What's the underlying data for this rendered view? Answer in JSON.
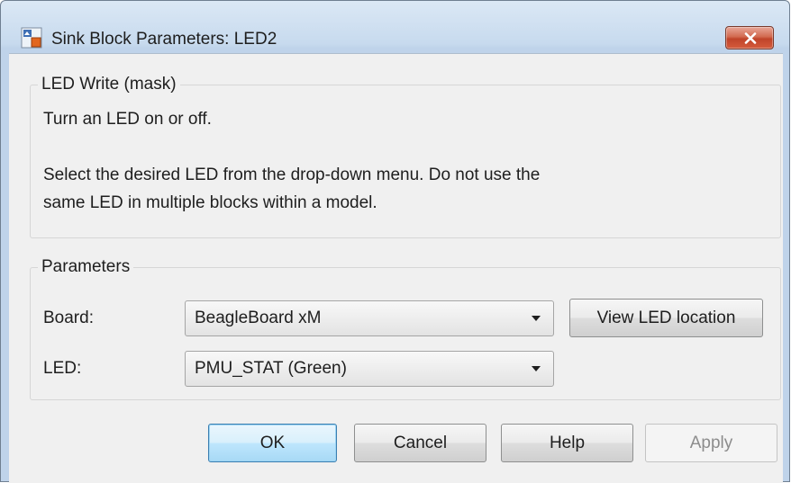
{
  "window": {
    "title": "Sink Block Parameters: LED2"
  },
  "mask_group": {
    "title": "LED Write (mask)",
    "description_line1": "Turn an LED on or off.",
    "description_line2": "Select the desired LED from the drop-down menu. Do not use the",
    "description_line3": "same LED in multiple blocks within a model."
  },
  "parameters": {
    "title": "Parameters",
    "board_label": "Board:",
    "board_value": "BeagleBoard xM",
    "view_led_label": "View LED location",
    "led_label": "LED:",
    "led_value": "PMU_STAT (Green)"
  },
  "buttons": {
    "ok": "OK",
    "cancel": "Cancel",
    "help": "Help",
    "apply": "Apply"
  },
  "colors": {
    "title_bar": "#c7daee",
    "close_button": "#c0442a",
    "dialog_background": "#f0f0f0",
    "default_button": "#bee6fd"
  },
  "icons": {
    "app": "simulink-block-icon",
    "close": "close-icon",
    "dropdown": "chevron-down-icon"
  }
}
